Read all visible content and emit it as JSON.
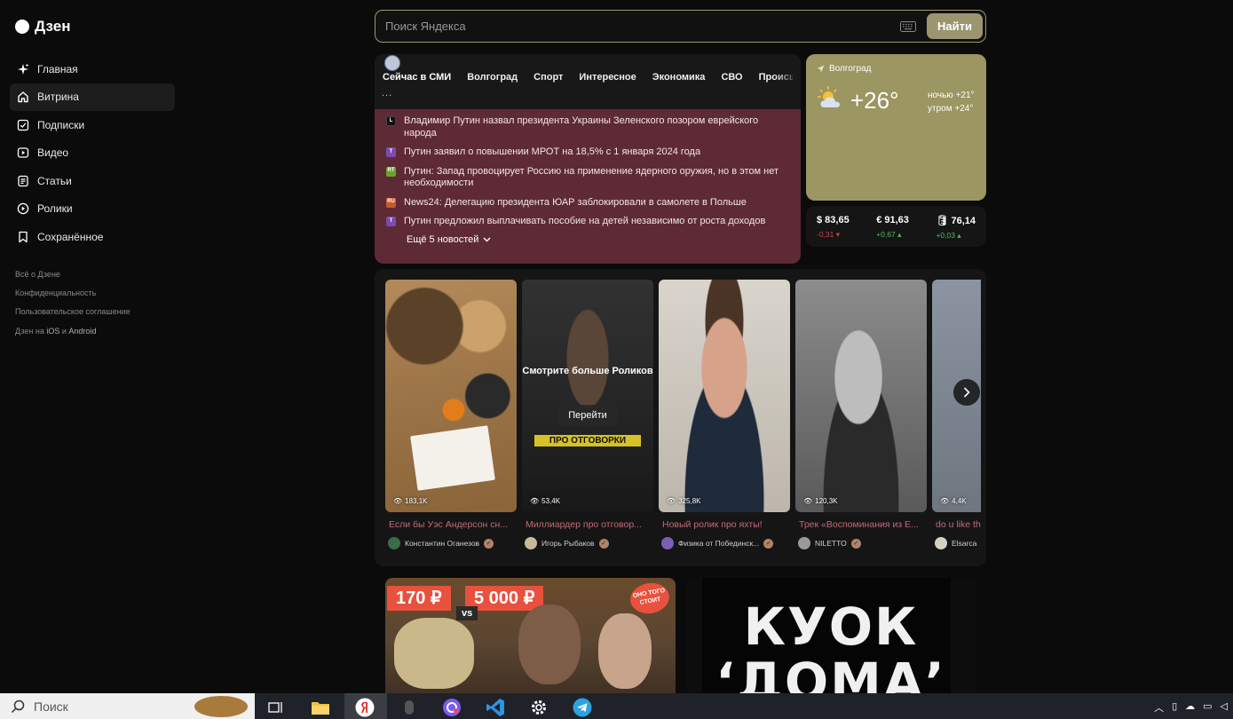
{
  "app": {
    "logo_text": "Дзен"
  },
  "sidebar": {
    "items": [
      {
        "label": "Главная",
        "icon": "sparkle-icon",
        "active": false
      },
      {
        "label": "Витрина",
        "icon": "home-icon",
        "active": true
      },
      {
        "label": "Подписки",
        "icon": "subscriptions-icon",
        "active": false
      },
      {
        "label": "Видео",
        "icon": "video-icon",
        "active": false
      },
      {
        "label": "Статьи",
        "icon": "articles-icon",
        "active": false
      },
      {
        "label": "Ролики",
        "icon": "shorts-icon",
        "active": false
      },
      {
        "label": "Сохранённое",
        "icon": "bookmark-icon",
        "active": false
      }
    ],
    "footer_links": [
      "Всё о Дзене",
      "Конфиденциальность",
      "Пользовательское соглашение"
    ],
    "apps_link": {
      "prefix": "Дзен на ",
      "ios": "iOS",
      "mid": " и ",
      "android": "Android"
    }
  },
  "search": {
    "placeholder": "Поиск Яндекса",
    "value": "",
    "button_label": "Найти"
  },
  "news": {
    "tabs": [
      "Сейчас в СМИ",
      "Волгоград",
      "Спорт",
      "Интересное",
      "Экономика",
      "СВО",
      "Происшествия"
    ],
    "more_dots": "...",
    "items": [
      {
        "source_mark": "L",
        "source_color": "#111111",
        "text": "Владимир Путин назвал президента Украины Зеленского позором еврейского народа"
      },
      {
        "source_mark": "Т",
        "source_color": "#7b4bb0",
        "text": "Путин заявил о повышении МРОТ на 18,5% с 1 января 2024 года"
      },
      {
        "source_mark": "RT",
        "source_color": "#69a52b",
        "text": "Путин: Запад провоцирует Россию на применение ядерного оружия, но в этом нет необходимости"
      },
      {
        "source_mark": "RU",
        "source_color": "#c85a2a",
        "text": "News24: Делегацию президента ЮАР заблокировали в самолете в Польше"
      },
      {
        "source_mark": "Т",
        "source_color": "#7b4bb0",
        "text": "Путин предложил выплачивать пособие на детей независимо от роста доходов"
      }
    ],
    "more_label": "Ещё 5 новостей"
  },
  "weather": {
    "city": "Волгоград",
    "temp": "+26°",
    "night": "ночью +21°",
    "morning": "утром +24°",
    "bg_color": "#9b9662"
  },
  "rates": [
    {
      "value": "$ 83,65",
      "change": "-0,31",
      "direction": "down"
    },
    {
      "value": "€ 91,63",
      "change": "+0,67",
      "direction": "up"
    },
    {
      "value": "🛢 76,14",
      "change": "+0,03",
      "direction": "up"
    }
  ],
  "videos": [
    {
      "views": "183,1K",
      "title": "Если бы Уэс Андерсон сн...",
      "channel": "Константин Оганезов"
    },
    {
      "views": "53,4K",
      "title": "Миллиардер про отговор...",
      "channel": "Игорь Рыбаков",
      "overlay": "Смотрите больше Роликов",
      "overlay_button": "Перейти",
      "tag": "ПРО ОТГОВОРКИ"
    },
    {
      "views": "325,8K",
      "title": "Новый ролик про яхты!",
      "channel": "Физика от Побединск..."
    },
    {
      "views": "120,3K",
      "title": "Трек «Воспоминания из Е...",
      "channel": "NILETTO"
    },
    {
      "views": "4,4K",
      "title": "do u like th",
      "channel": "Elsarca"
    }
  ],
  "cards": {
    "card1_price_a": "170 ₽",
    "card1_price_b": "5 000 ₽",
    "card1_vs": "vs",
    "card1_badge": "ОНО ТОГО СТОИТ",
    "card2_title": "КУОК ‘ДОМА’"
  },
  "taskbar": {
    "search_placeholder": "Поиск"
  }
}
